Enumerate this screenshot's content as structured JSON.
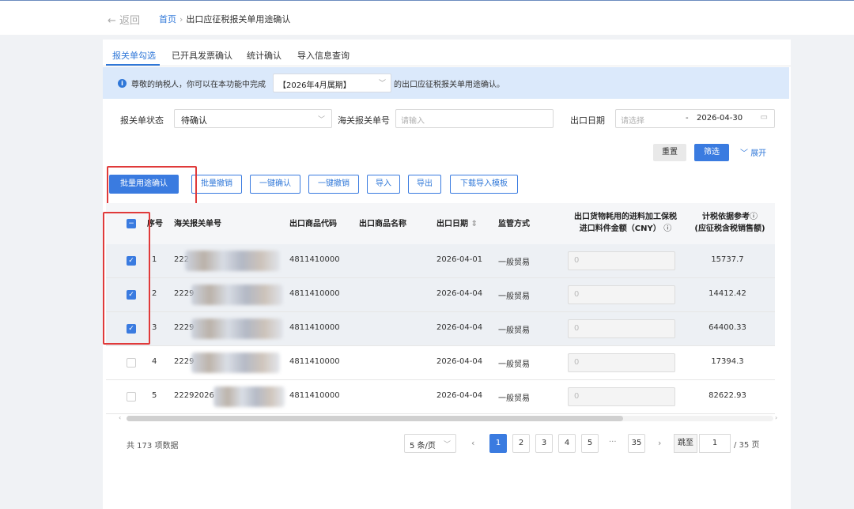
{
  "topbar": {
    "back_label": "返回",
    "breadcrumb_home": "首页",
    "breadcrumb_current": "出口应征税报关单用途确认"
  },
  "tabs": [
    {
      "label": "报关单勾选",
      "active": true
    },
    {
      "label": "已开具发票确认",
      "active": false
    },
    {
      "label": "统计确认",
      "active": false
    },
    {
      "label": "导入信息查询",
      "active": false
    }
  ],
  "notice": {
    "text": "尊敬的纳税人，你可以在本功能中完成",
    "period": "【2026年4月属期】",
    "tail": "的出口应征税报关单用途确认。"
  },
  "filters": {
    "status_label": "报关单状态",
    "status_value": "待确认",
    "customs_no_label": "海关报关单号",
    "customs_no_placeholder": "请输入",
    "date_label": "出口日期",
    "date_start_placeholder": "请选择",
    "date_separator": "-",
    "date_end": "2026-04-30",
    "reset_label": "重置",
    "filter_label": "筛选",
    "expand_label": "展开"
  },
  "actions": {
    "batch_confirm": "批量用途确认",
    "batch_revoke": "批量撤销",
    "one_click_confirm": "一键确认",
    "one_click_revoke": "一键撤销",
    "import": "导入",
    "export": "导出",
    "download_template": "下载导入模板"
  },
  "table": {
    "headers": {
      "seq": "序号",
      "customs_no": "海关报关单号",
      "goods_code": "出口商品代码",
      "goods_name": "出口商品名称",
      "export_date": "出口日期",
      "supervision": "监管方式",
      "import_amount_line1": "出口货物耗用的进料加工保税",
      "import_amount_line2": "进口料件金额（CNY）",
      "tax_basis_line1": "计税依据参考",
      "tax_basis_line2": "(应征税含税销售额)"
    },
    "rows": [
      {
        "seq": "1",
        "customs_no": "222",
        "goods_code": "4811410000",
        "goods_name": "",
        "export_date": "2026-04-01",
        "supervision": "一般贸易",
        "import_amount": "0",
        "tax_basis": "15737.7",
        "checked": true
      },
      {
        "seq": "2",
        "customs_no": "2229",
        "goods_code": "4811410000",
        "goods_name": "",
        "export_date": "2026-04-04",
        "supervision": "一般贸易",
        "import_amount": "0",
        "tax_basis": "14412.42",
        "checked": true
      },
      {
        "seq": "3",
        "customs_no": "2229",
        "goods_code": "4811410000",
        "goods_name": "",
        "export_date": "2026-04-04",
        "supervision": "一般贸易",
        "import_amount": "0",
        "tax_basis": "64400.33",
        "checked": true
      },
      {
        "seq": "4",
        "customs_no": "2229",
        "goods_code": "4811410000",
        "goods_name": "",
        "export_date": "2026-04-04",
        "supervision": "一般贸易",
        "import_amount": "0",
        "tax_basis": "17394.3",
        "checked": false
      },
      {
        "seq": "5",
        "customs_no": "22292026",
        "goods_code": "4811410000",
        "goods_name": "",
        "export_date": "2026-04-04",
        "supervision": "一般贸易",
        "import_amount": "0",
        "tax_basis": "82622.93",
        "checked": false
      }
    ]
  },
  "pagination": {
    "total_text": "共 173 项数据",
    "page_size": "5 条/页",
    "pages": [
      "1",
      "2",
      "3",
      "4",
      "5"
    ],
    "current_page": "1",
    "ellipsis": "···",
    "last_page": "35",
    "jump_label": "跳至",
    "jump_value": "1",
    "total_pages": "/ 35 页"
  },
  "colors": {
    "accent": "#3a7be0",
    "notice_bg": "#dbe9fb",
    "highlight_border": "#e03a3a"
  }
}
